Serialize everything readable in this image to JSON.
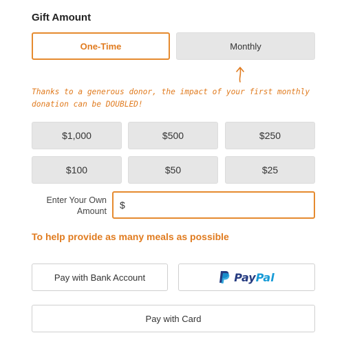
{
  "gift": {
    "title": "Gift Amount",
    "frequency": {
      "one_time": "One-Time",
      "monthly": "Monthly",
      "selected": "One-Time"
    },
    "note": "Thanks to a generous donor, the impact of your first monthly donation can be DOUBLED!",
    "amounts": [
      "$1,000",
      "$500",
      "$250",
      "$100",
      "$50",
      "$25"
    ],
    "own_amount": {
      "label_line1": "Enter Your Own",
      "label_line2": "Amount",
      "prefix": "$",
      "value": ""
    },
    "help_text": "To help provide as many meals as possible"
  },
  "payment": {
    "bank": "Pay with Bank Account",
    "paypal": {
      "part1": "Pay",
      "part2": "Pal"
    },
    "card": "Pay with Card"
  },
  "colors": {
    "accent": "#e07b1f",
    "button_gray": "#e6e6e6",
    "paypal_dark": "#253b80",
    "paypal_light": "#179bd7"
  },
  "icons": [
    "up-arrow-icon",
    "paypal-logo-icon"
  ]
}
